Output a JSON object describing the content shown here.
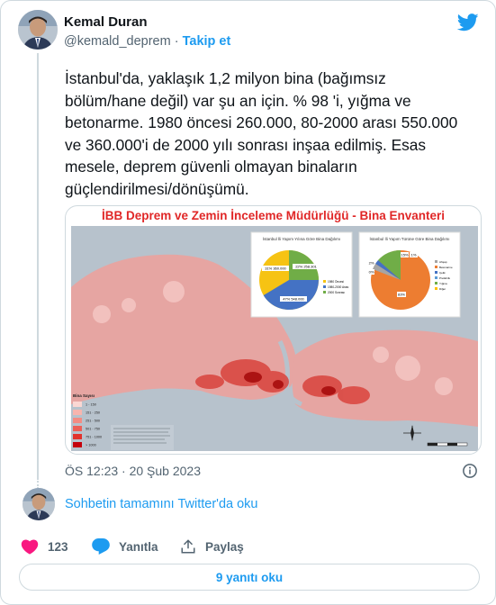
{
  "author": {
    "name": "Kemal Duran",
    "handle": "@kemald_deprem",
    "separator": "·",
    "follow_label": "Takip et"
  },
  "tweet": {
    "text": "İstanbul'da, yaklaşık 1,2 milyon bina (bağımsız bölüm/hane değil) var şu an için. % 98 'i, yığma ve betonarme. 1980 öncesi 260.000, 80-2000 arası 550.000 ve 360.000'i de 2000 yılı sonrası inşaa edilmiş. Esas mesele, deprem güvenli olmayan binaların güçlendirilmesi/dönüşümü.",
    "timestamp": "ÖS 12:23 · 20 Şub 2023"
  },
  "media": {
    "title": "İBB Deprem ve Zemin İnceleme Müdürlüğü - Bina Envanteri",
    "pie1": {
      "title": "İstanbul İli Yapım Yılına Göre Bina Dağılımı",
      "slices": [
        {
          "label": "31% 360.000",
          "value": 31,
          "color": "#f6c313"
        },
        {
          "label": "47% 548.000",
          "value": 47,
          "color": "#4472c4"
        },
        {
          "label": "22% 258.301",
          "value": 22,
          "color": "#70ad47"
        }
      ],
      "legend": [
        "1980 Öncesi",
        "1980-2000 Arası",
        "2000 Sonrası"
      ]
    },
    "pie2": {
      "title": "İstanbul İli Yapım Türüne Göre Bina Dağılımı",
      "slices": [
        {
          "label": "83%",
          "value": 83,
          "color": "#ed7d31"
        },
        {
          "label": "15%",
          "value": 15,
          "color": "#70ad47"
        },
        {
          "label": "1%",
          "value": 1,
          "color": "#a5a5a5"
        },
        {
          "label": "0%",
          "value": 0.5,
          "color": "#4472c4"
        },
        {
          "label": "2%",
          "value": 1.5,
          "color": "#5b9bd5"
        }
      ],
      "legend": [
        "Ahşap",
        "Betonarme",
        "Çelik",
        "Prefabrik",
        "Yığma",
        "Diğer"
      ]
    },
    "map_legend": {
      "title": "Bina Sayısı",
      "items": [
        {
          "label": "1 - 150",
          "color": "#fbd7d3"
        },
        {
          "label": "151 - 250",
          "color": "#f8b5ae"
        },
        {
          "label": "251 - 500",
          "color": "#f38c83"
        },
        {
          "label": "501 - 750",
          "color": "#ed5f56"
        },
        {
          "label": "751 - 1000",
          "color": "#e2322c"
        },
        {
          "label": "> 1000",
          "color": "#c4000c"
        }
      ]
    }
  },
  "conversation": {
    "link_label": "Sohbetin tamamını Twitter'da oku"
  },
  "actions": {
    "like_count": "123",
    "reply_label": "Yanıtla",
    "share_label": "Paylaş"
  },
  "replies_button": {
    "label": "9 yanıtı oku"
  },
  "colors": {
    "accent": "#1d9bf0",
    "like": "#f91880",
    "text": "#0f1419",
    "muted": "#536471",
    "border": "#cfd9de"
  }
}
